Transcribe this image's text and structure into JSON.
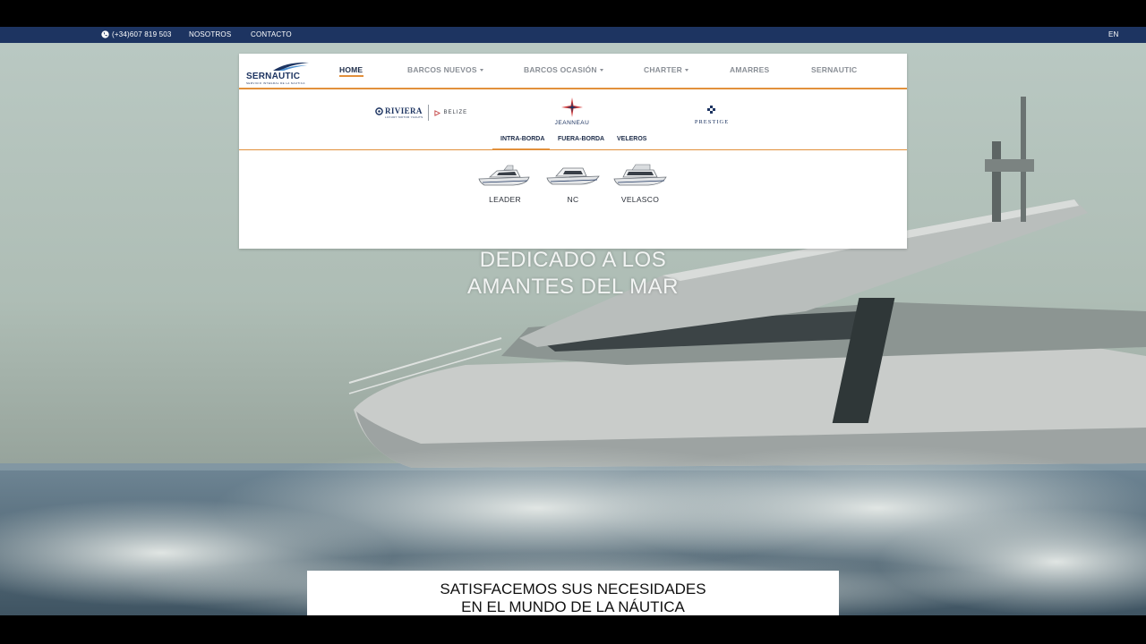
{
  "topbar": {
    "phone": "(+34)607 819 503",
    "links": [
      "NOSOTROS",
      "CONTACTO"
    ],
    "lang": "EN",
    "phone_icon": "phone-icon"
  },
  "logo": {
    "name": "SERNAUTIC",
    "tagline": "SERVICIO INTEGRAL DE LA NAUTICA"
  },
  "nav": {
    "items": [
      {
        "label": "HOME",
        "active": true,
        "dropdown": false
      },
      {
        "label": "BARCOS NUEVOS",
        "active": false,
        "dropdown": true
      },
      {
        "label": "BARCOS OCASIÓN",
        "active": false,
        "dropdown": true
      },
      {
        "label": "CHARTER",
        "active": false,
        "dropdown": true
      },
      {
        "label": "AMARRES",
        "active": false,
        "dropdown": false
      },
      {
        "label": "SERNAUTIC",
        "active": false,
        "dropdown": false
      }
    ]
  },
  "brands": {
    "riviera": "RIVIERA",
    "riviera_sub": "LUXURY MOTOR YACHTS",
    "belize": "BELIZE",
    "jeanneau": "JEANNEAU",
    "prestige": "PRESTIGE"
  },
  "subtabs": {
    "items": [
      "INTRA-BORDA",
      "FUERA-BORDA",
      "VELEROS"
    ],
    "active": "INTRA-BORDA"
  },
  "models": [
    "LEADER",
    "NC",
    "VELASCO"
  ],
  "hero": {
    "line1": "DEDICADO A LOS",
    "line2": "AMANTES DEL MAR"
  },
  "tagline": {
    "line1": "SATISFACEMOS SUS NECESIDADES",
    "line2": "EN EL MUNDO DE LA NÁUTICA"
  },
  "colors": {
    "navy": "#1d3461",
    "accent": "#e2903b"
  }
}
